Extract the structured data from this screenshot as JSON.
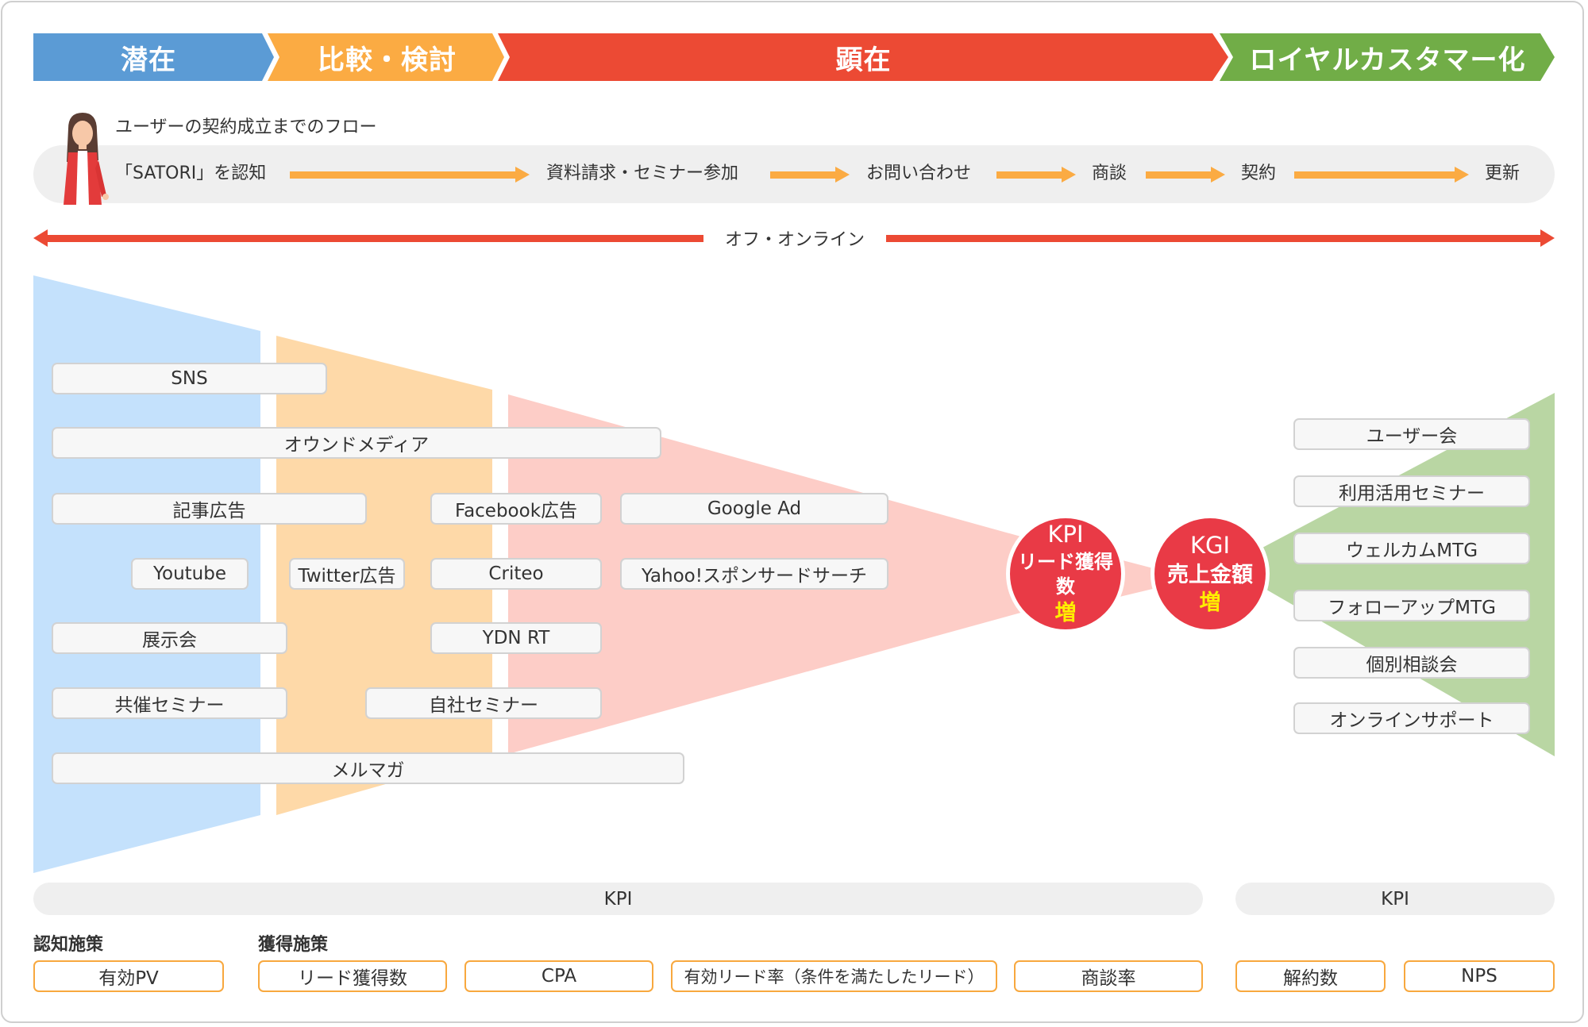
{
  "stages": [
    {
      "label": "潜在",
      "color": "#5b9bd5"
    },
    {
      "label": "比較・検討",
      "color": "#fbab43"
    },
    {
      "label": "顕在",
      "color": "#ec4a34"
    },
    {
      "label": "ロイヤルカスタマー化",
      "color": "#71ad47"
    }
  ],
  "flow": {
    "title": "ユーザーの契約成立までのフロー",
    "steps": [
      "「SATORI」を認知",
      "資料請求・セミナー参加",
      "お問い合わせ",
      "商談",
      "契約",
      "更新"
    ]
  },
  "channel_range": {
    "label": "オフ・オンライン"
  },
  "funnel": {
    "colors": {
      "awareness": "#c4e1fc",
      "consideration": "#fed9a8",
      "apparent": "#fdcdc7",
      "loyal": "#b9d6a3"
    },
    "channels": [
      {
        "label": "SNS"
      },
      {
        "label": "オウンドメディア"
      },
      {
        "label": "記事広告"
      },
      {
        "label": "Facebook広告"
      },
      {
        "label": "Google Ad"
      },
      {
        "label": "Youtube"
      },
      {
        "label": "Twitter広告"
      },
      {
        "label": "Criteo"
      },
      {
        "label": "Yahoo!スポンサードサーチ"
      },
      {
        "label": "展示会"
      },
      {
        "label": "YDN RT"
      },
      {
        "label": "共催セミナー"
      },
      {
        "label": "自社セミナー"
      },
      {
        "label": "メルマガ"
      }
    ]
  },
  "goals": {
    "kpi": {
      "title": "KPI",
      "metric": "リード獲得数",
      "trend": "増"
    },
    "kgi": {
      "title": "KGI",
      "metric": "売上金額",
      "trend": "増"
    }
  },
  "loyalty_programs": [
    "ユーザー会",
    "利用活用セミナー",
    "ウェルカムMTG",
    "フォローアップMTG",
    "個別相談会",
    "オンラインサポート"
  ],
  "kpi_section": {
    "left_label": "KPI",
    "right_label": "KPI",
    "groups": [
      {
        "label": "認知施策",
        "items": [
          "有効PV"
        ]
      },
      {
        "label": "獲得施策",
        "items": [
          "リード獲得数",
          "CPA",
          "有効リード率（条件を満たしたリード）",
          "商談率"
        ]
      }
    ],
    "retention_items": [
      "解約数",
      "NPS"
    ]
  }
}
